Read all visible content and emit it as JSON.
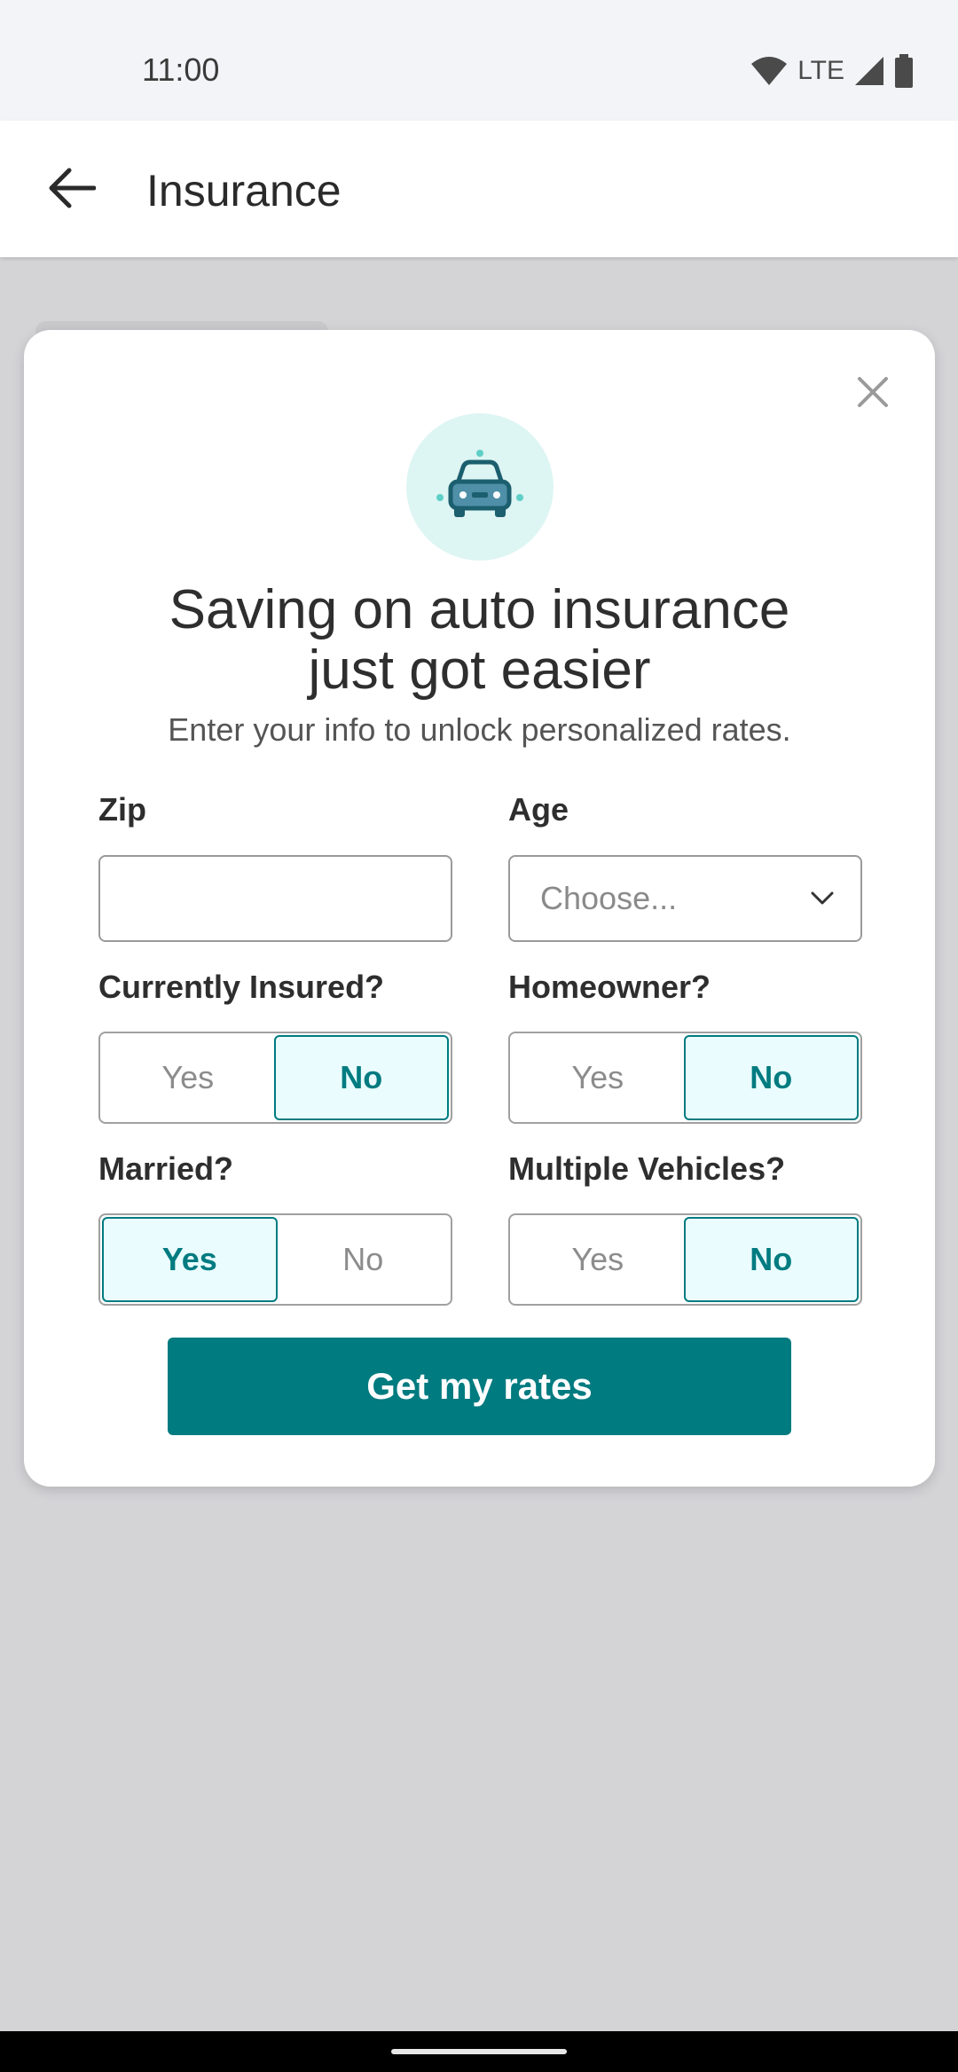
{
  "status_bar": {
    "time": "11:00",
    "network": "LTE"
  },
  "app_bar": {
    "title": "Insurance"
  },
  "modal": {
    "headline_line1": "Saving on auto insurance",
    "headline_line2": "just got easier",
    "subline": "Enter your info to unlock personalized rates.",
    "zip": {
      "label": "Zip",
      "value": ""
    },
    "age": {
      "label": "Age",
      "placeholder": "Choose..."
    },
    "currently_insured": {
      "label": "Currently Insured?",
      "yes": "Yes",
      "no": "No",
      "selected": "No"
    },
    "homeowner": {
      "label": "Homeowner?",
      "yes": "Yes",
      "no": "No",
      "selected": "No"
    },
    "married": {
      "label": "Married?",
      "yes": "Yes",
      "no": "No",
      "selected": "Yes"
    },
    "multiple_vehicles": {
      "label": "Multiple Vehicles?",
      "yes": "Yes",
      "no": "No",
      "selected": "No"
    },
    "cta_label": "Get my rates"
  },
  "colors": {
    "accent": "#007b80",
    "selected_bg": "#eafcfd",
    "icon_circle": "#ddf5f3"
  }
}
